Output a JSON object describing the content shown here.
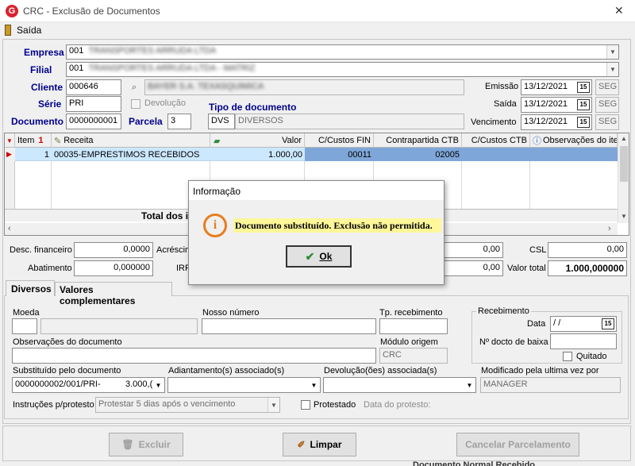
{
  "window": {
    "title": "CRC - Exclusão de Documentos",
    "close": "✕"
  },
  "menu": {
    "exit": "Saída"
  },
  "header": {
    "empresa_label": "Empresa",
    "empresa_value": "001",
    "filial_label": "Filial",
    "filial_value": "001",
    "cliente_label": "Cliente",
    "cliente_value": "000646",
    "serie_label": "Série",
    "serie_value": "PRI",
    "devolucao_label": "Devolução",
    "documento_label": "Documento",
    "documento_value": "0000000001",
    "parcela_label": "Parcela",
    "parcela_value": "3",
    "tipo_label": "Tipo de documento",
    "tipo_code": "DVS",
    "tipo_desc": "DIVERSOS",
    "emissao_label": "Emissão",
    "emissao_value": "13/12/2021",
    "emissao_day": "SEG",
    "saida_label": "Saída",
    "saida_value": "13/12/2021",
    "saida_day": "SEG",
    "vencimento_label": "Vencimento",
    "vencimento_value": "13/12/2021",
    "vencimento_day": "SEG"
  },
  "grid": {
    "columns": [
      "Item",
      "Receita",
      "Valor",
      "C/Custos FIN",
      "Contrapartida CTB",
      "C/Custos CTB",
      "Observações do ite"
    ],
    "rows": [
      {
        "item": "1",
        "receita": "00035-EMPRESTIMOS RECEBIDOS",
        "valor": "1.000,00",
        "ccfin": "00011",
        "contrapartida": "02005",
        "ccctb": "",
        "obs": ""
      }
    ],
    "total_label": "Total dos i"
  },
  "totals": {
    "desc_fin_label": "Desc. financeiro",
    "desc_fin_value": "0,0000",
    "acrescimo_label": "Acréscim",
    "abatimento_label": "Abatimento",
    "abatimento_value": "0,000000",
    "irrf_label": "IRR",
    "mid1_value": "0,00",
    "mid2_value": "0,00",
    "csl_label": "CSL",
    "csl_value": "0,00",
    "valor_total_label": "Valor total",
    "valor_total_value": "1.000,000000"
  },
  "tabs": [
    {
      "label": "Diversos"
    },
    {
      "label": "Valores complementares"
    }
  ],
  "diversos": {
    "moeda_label": "Moeda",
    "nosso_numero_label": "Nosso número",
    "tp_recebimento_label": "Tp. recebimento",
    "recebimento_group": "Recebimento",
    "data_label": "Data",
    "data_value": " /  /",
    "n_baixa_label": "Nº docto de baixa",
    "quitado_label": "Quitado",
    "obs_label": "Observações do documento",
    "modulo_label": "Módulo origem",
    "modulo_value": "CRC",
    "subst_label": "Substituído pelo documento",
    "subst_doc": "0000000002/001/PRI-",
    "subst_val": "3.000,(",
    "adiant_label": "Adiantamento(s) associado(s)",
    "devol_label": "Devolução(ões) associada(s)",
    "modificado_label": "Modificado pela ultima vez por",
    "modificado_value": "MANAGER",
    "instrucoes_label": "Instruções p/protesto",
    "instrucoes_value": "Protestar 5 dias após o vencimento",
    "protestado_label": "Protestado",
    "data_protesto_label": "Data do protesto:"
  },
  "buttons": {
    "excluir": "Excluir",
    "limpar": "Limpar",
    "cancelar": "Cancelar Parcelamento"
  },
  "dialog": {
    "title": "Informação",
    "message": "Documento substituído. Exclusão não permitida.",
    "ok": "Ok"
  },
  "background": {
    "status_text": "Documento Normal   Recebido"
  },
  "colors": {
    "label_blue": "#00008b",
    "selected_row": "#cce8ff",
    "selected_cell": "#7fa6d8",
    "message_bg": "#fff799",
    "info_orange": "#e87d1e",
    "title_red": "#d9232e"
  }
}
